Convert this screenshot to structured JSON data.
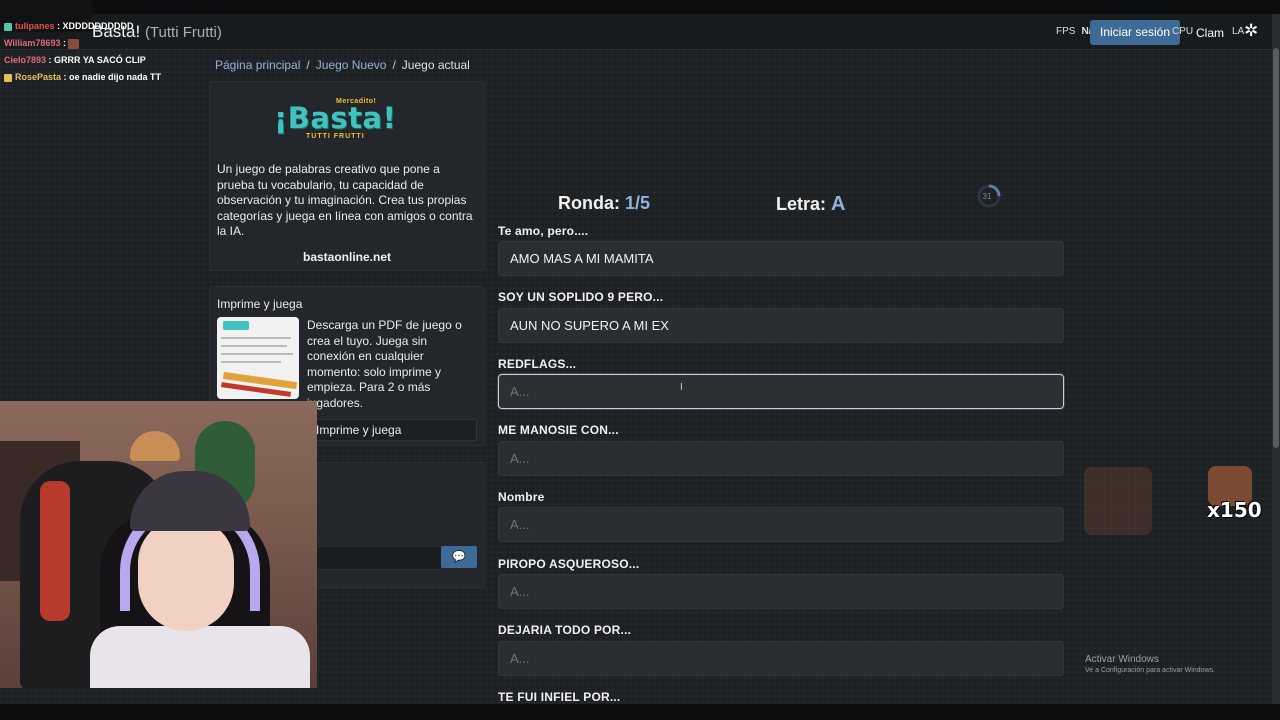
{
  "navbar": {
    "brand": "Basta!",
    "brand_sub": "(Tutti Frutti)",
    "fps_label": "FPS",
    "fps_value": "N/A",
    "login_label": "Iniciar sesión",
    "cpu_label": "CPU",
    "clam_label": "Clam",
    "lang_label": "LA"
  },
  "breadcrumb": {
    "home": "Página principal",
    "sep": "/",
    "new_game": "Juego Nuevo",
    "current": "Juego actual"
  },
  "info_panel": {
    "logo_small": "Mercadito!",
    "logo_main": "¡Basta!",
    "logo_sub": "TUTTI FRUTTI",
    "description": "Un juego de palabras creativo que pone a prueba tu vocabulario, tu capacidad de observación y tu imaginación. Crea tus propias categorías y juega en línea con amigos o contra la IA.",
    "site": "bastaonline.net"
  },
  "print_panel": {
    "title": "Imprime y juega",
    "description": "Descarga un PDF de juego o crea el tuyo. Juega sin conexión en cualquier momento: solo imprime y empieza. Para 2 o más jugadores.",
    "button_label": "Imprime y juega"
  },
  "stream_chat": [
    {
      "user": "tulipanes",
      "msg": ": XDDDDDDDDDD",
      "color": "#e3534a"
    },
    {
      "user": "William78693",
      "msg": ":",
      "color": "#e06a7c"
    },
    {
      "user": "Cielo7893",
      "msg": ": GRRR YA SACÓ CLIP",
      "color": "#e06a7c"
    },
    {
      "user": "RosePasta",
      "msg": ": oe nadie dijo nada TT",
      "color": "#e8bf5e"
    }
  ],
  "game": {
    "round_label": "Ronda:",
    "round_value": "1/5",
    "letter_label": "Letra:",
    "letter_value": "A",
    "timer": "31",
    "categories": [
      {
        "label": "Te amo, pero....",
        "value": "AMO MAS A MI MAMITA",
        "placeholder": "A..."
      },
      {
        "label": "SOY UN SOPLIDO 9 PERO...",
        "value": "AUN NO SUPERO A MI EX",
        "placeholder": "A..."
      },
      {
        "label": "REDFLAGS...",
        "value": "",
        "placeholder": "A..."
      },
      {
        "label": "ME MANOSIE CON...",
        "value": "",
        "placeholder": "A..."
      },
      {
        "label": "Nombre",
        "value": "",
        "placeholder": "A..."
      },
      {
        "label": "PIROPO ASQUEROSO...",
        "value": "",
        "placeholder": "A..."
      },
      {
        "label": "DEJARIA TODO POR...",
        "value": "",
        "placeholder": "A..."
      },
      {
        "label": "TE FUI INFIEL POR...",
        "value": "",
        "placeholder": "A..."
      }
    ]
  },
  "overlay": {
    "emote_count": "x150",
    "windows_line1": "Activar Windows",
    "windows_line2": "Ve a Configuración para activar Windows."
  },
  "colors": {
    "accent": "#8fb4db",
    "button": "#3d6b95",
    "logo": "#3fc3c0"
  }
}
